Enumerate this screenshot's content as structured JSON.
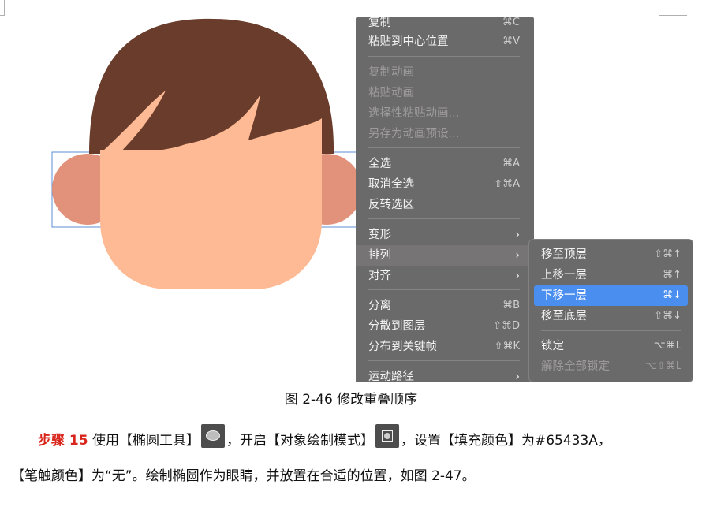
{
  "colors": {
    "hair": "#693c2b",
    "face": "#feba94",
    "ear": "#e2927b",
    "selection": "#5b8fd6",
    "menu_bg": "#6b6a6a",
    "menu_highlight": "#4a8ff0",
    "step_red": "#d9261c"
  },
  "menu": {
    "items": [
      {
        "label": "复制",
        "shortcut": "⌘C"
      },
      {
        "label": "粘贴到中心位置",
        "shortcut": "⌘V"
      },
      {
        "label": "复制动画",
        "shortcut": ""
      },
      {
        "label": "粘贴动画",
        "shortcut": ""
      },
      {
        "label": "选择性粘贴动画...",
        "shortcut": ""
      },
      {
        "label": "另存为动画预设...",
        "shortcut": ""
      },
      {
        "label": "全选",
        "shortcut": "⌘A"
      },
      {
        "label": "取消全选",
        "shortcut": "⇧⌘A"
      },
      {
        "label": "反转选区",
        "shortcut": ""
      },
      {
        "label": "变形",
        "shortcut": "›"
      },
      {
        "label": "排列",
        "shortcut": "›"
      },
      {
        "label": "对齐",
        "shortcut": "›"
      },
      {
        "label": "分离",
        "shortcut": "⌘B"
      },
      {
        "label": "分散到图层",
        "shortcut": "⇧⌘D"
      },
      {
        "label": "分布到关键帧",
        "shortcut": "⇧⌘K"
      },
      {
        "label": "运动路径",
        "shortcut": "›"
      }
    ]
  },
  "submenu": {
    "items": [
      {
        "label": "移至顶层",
        "shortcut": "⇧⌘↑"
      },
      {
        "label": "上移一层",
        "shortcut": "⌘↑"
      },
      {
        "label": "下移一层",
        "shortcut": "⌘↓"
      },
      {
        "label": "移至底层",
        "shortcut": "⇧⌘↓"
      },
      {
        "label": "锁定",
        "shortcut": "⌥⌘L"
      },
      {
        "label": "解除全部锁定",
        "shortcut": "⌥⇧⌘L"
      }
    ]
  },
  "caption": "图  2-46  修改重叠顺序",
  "paragraph": {
    "step_label": "步骤 15",
    "line1_a": "使用【椭圆工具】",
    "line1_b": "，开启【对象绘制模式】",
    "line1_c": "，设置【填充颜色】为#65433A，",
    "line2": "【笔触颜色】为“无”。绘制椭圆作为眼睛，并放置在合适的位置，如图 2-47。"
  }
}
